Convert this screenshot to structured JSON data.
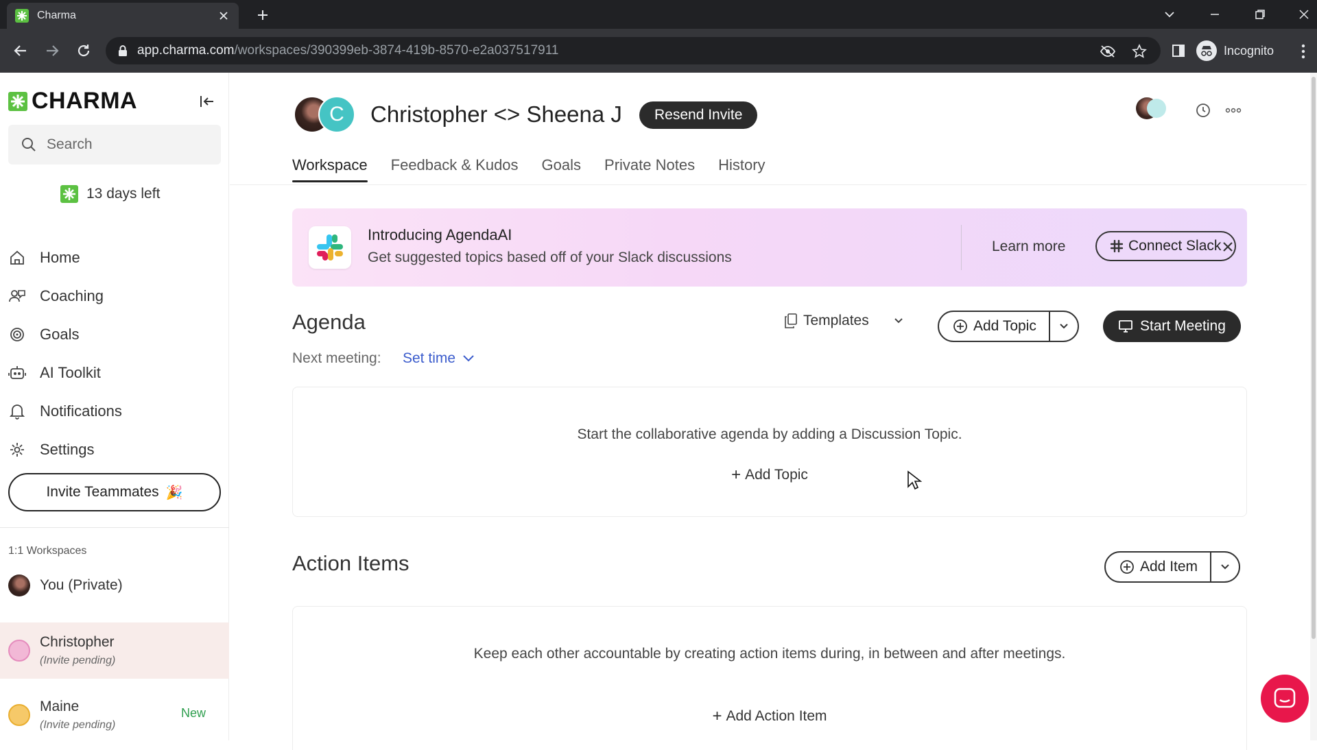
{
  "browser": {
    "tab_title": "Charma",
    "url_host": "app.charma.com",
    "url_path": "/workspaces/390399eb-3874-419b-8570-e2a037517911",
    "profile_label": "Incognito"
  },
  "sidebar": {
    "logo_text": "CHARMA",
    "search_placeholder": "Search",
    "trial_text": "13 days left",
    "nav": [
      {
        "label": "Home",
        "icon": "home-icon"
      },
      {
        "label": "Coaching",
        "icon": "coaching-icon"
      },
      {
        "label": "Goals",
        "icon": "goals-icon"
      },
      {
        "label": "AI Toolkit",
        "icon": "robot-icon"
      },
      {
        "label": "Notifications",
        "icon": "bell-icon"
      },
      {
        "label": "Settings",
        "icon": "gear-icon"
      }
    ],
    "invite_label": "Invite Teammates",
    "invite_emoji": "🎉",
    "workspaces_heading": "1:1 Workspaces",
    "workspaces": [
      {
        "name": "You (Private)",
        "sub": ""
      },
      {
        "name": "Christopher",
        "sub": "(Invite pending)"
      },
      {
        "name": "Maine",
        "sub": "(Invite pending)",
        "badge": "New"
      }
    ]
  },
  "header": {
    "avatar_initial": "C",
    "title": "Christopher <> Sheena J",
    "resend_label": "Resend Invite"
  },
  "tabs": [
    "Workspace",
    "Feedback & Kudos",
    "Goals",
    "Private Notes",
    "History"
  ],
  "active_tab": "Workspace",
  "banner": {
    "title": "Introducing AgendaAI",
    "subtitle": "Get suggested topics based off of your Slack discussions",
    "learn_more": "Learn more",
    "connect_label": "Connect Slack"
  },
  "agenda": {
    "title": "Agenda",
    "templates_label": "Templates",
    "add_topic_label": "Add Topic",
    "start_meeting_label": "Start Meeting",
    "next_meeting_label": "Next meeting:",
    "set_time_label": "Set time",
    "empty_text": "Start the collaborative agenda by adding a Discussion Topic.",
    "add_topic_link": "Add Topic"
  },
  "action_items": {
    "title": "Action Items",
    "add_item_label": "Add Item",
    "empty_text": "Keep each other accountable by creating action items during, in between and after meetings.",
    "add_link": "Add Action Item"
  },
  "colors": {
    "brand_green": "#5cc142",
    "dark_button": "#2b2b2b",
    "link_blue": "#3b5ccc",
    "new_badge": "#2e9e4e",
    "chat_fab": "#e8174b"
  }
}
